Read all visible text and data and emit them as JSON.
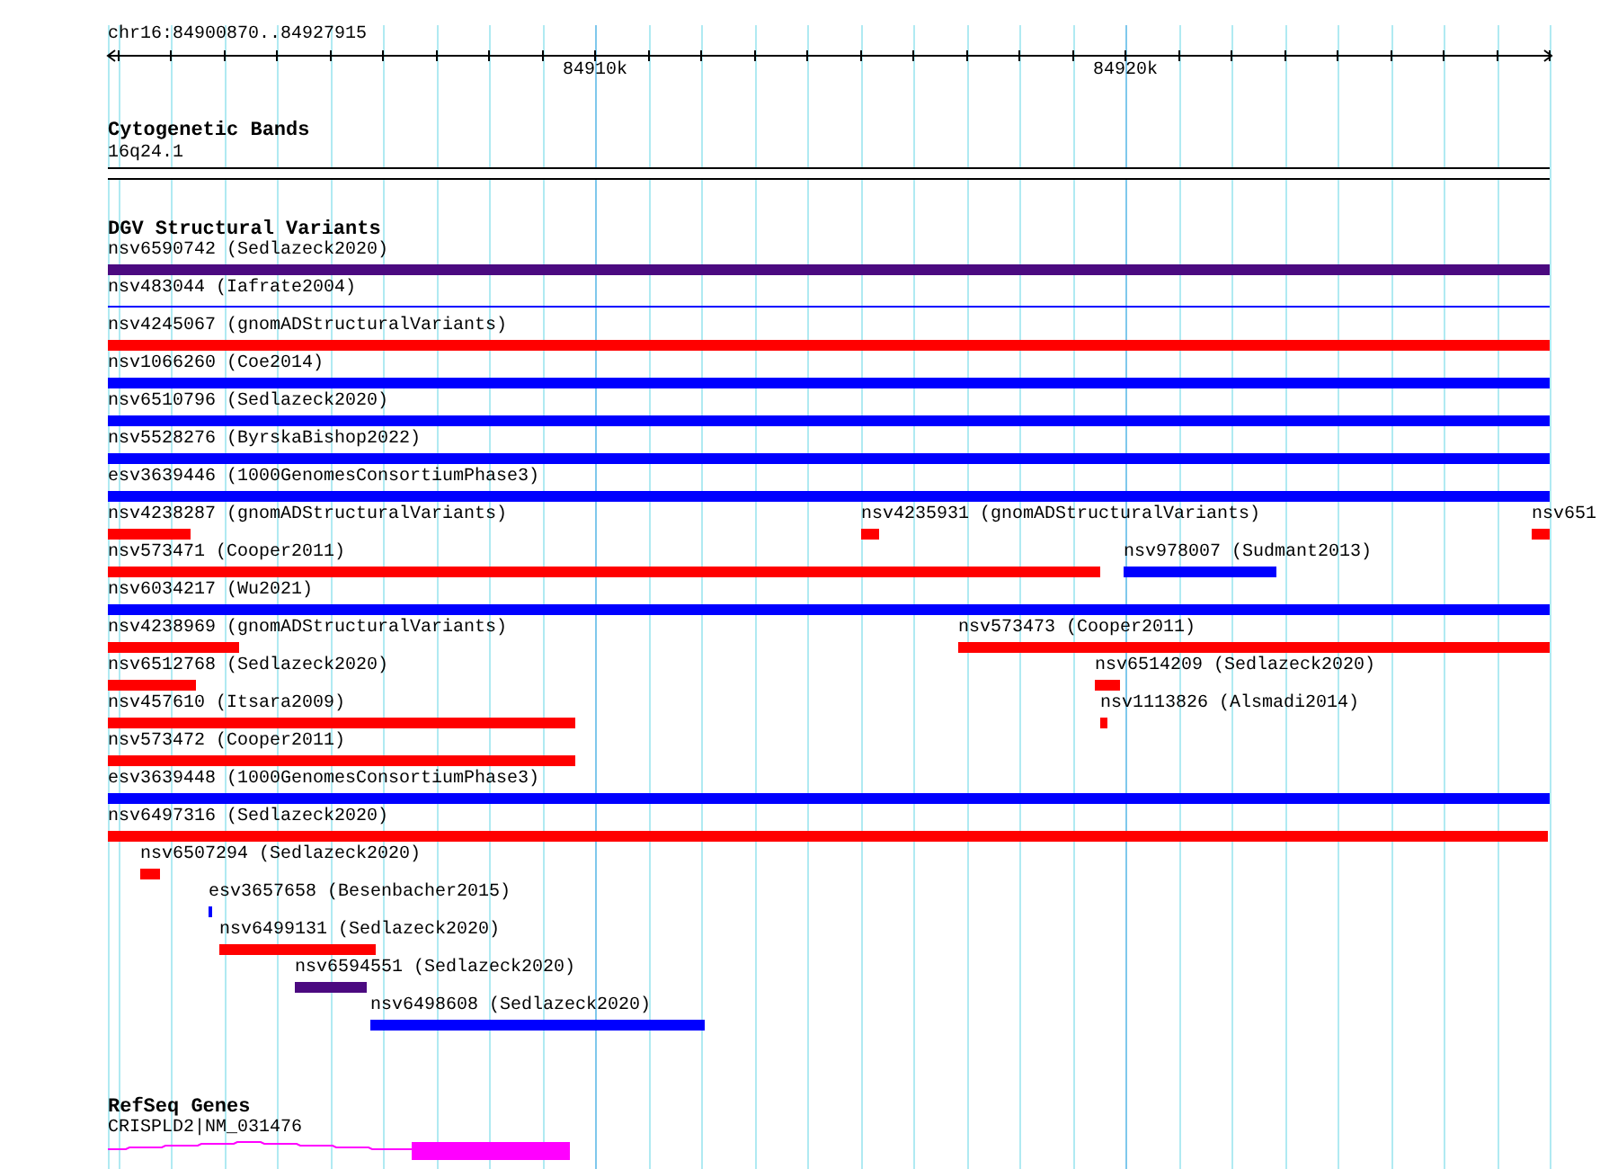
{
  "ruler": {
    "range": "chr16:84900870..84927915",
    "ticks": [
      "84910k",
      "84920k"
    ]
  },
  "cytoband_track": {
    "title": "Cytogenetic Bands",
    "band": "16q24.1"
  },
  "dgv_track": {
    "title": "DGV Structural Variants",
    "rows": [
      [
        {
          "label": "nsv6590742 (Sedlazeck2020)",
          "color": "#4b0a80"
        }
      ],
      [
        {
          "label": "nsv483044 (Iafrate2004)",
          "color": "#0000ff"
        }
      ],
      [
        {
          "label": "nsv4245067 (gnomADStructuralVariants)",
          "color": "#ff0000"
        }
      ],
      [
        {
          "label": "nsv1066260 (Coe2014)",
          "color": "#0000ff"
        }
      ],
      [
        {
          "label": "nsv6510796 (Sedlazeck2020)",
          "color": "#0000ff"
        }
      ],
      [
        {
          "label": "nsv5528276 (ByrskaBishop2022)",
          "color": "#0000ff"
        }
      ],
      [
        {
          "label": "esv3639446 (1000GenomesConsortiumPhase3)",
          "color": "#0000ff"
        }
      ],
      [
        {
          "label": "nsv4238287 (gnomADStructuralVariants)",
          "color": "#ff0000"
        },
        {
          "label": "nsv4235931 (gnomADStructuralVariants)",
          "color": "#ff0000"
        },
        {
          "label": "nsv651",
          "color": "#ff0000"
        }
      ],
      [
        {
          "label": "nsv573471 (Cooper2011)",
          "color": "#ff0000"
        },
        {
          "label": "nsv978007 (Sudmant2013)",
          "color": "#0000ff"
        }
      ],
      [
        {
          "label": "nsv6034217 (Wu2021)",
          "color": "#0000ff"
        }
      ],
      [
        {
          "label": "nsv4238969 (gnomADStructuralVariants)",
          "color": "#ff0000"
        },
        {
          "label": "nsv573473 (Cooper2011)",
          "color": "#ff0000"
        }
      ],
      [
        {
          "label": "nsv6512768 (Sedlazeck2020)",
          "color": "#ff0000"
        },
        {
          "label": "nsv6514209 (Sedlazeck2020)",
          "color": "#ff0000"
        }
      ],
      [
        {
          "label": "nsv457610 (Itsara2009)",
          "color": "#ff0000"
        },
        {
          "label": "nsv1113826 (Alsmadi2014)",
          "color": "#ff0000"
        }
      ],
      [
        {
          "label": "nsv573472 (Cooper2011)",
          "color": "#ff0000"
        }
      ],
      [
        {
          "label": "esv3639448 (1000GenomesConsortiumPhase3)",
          "color": "#0000ff"
        }
      ],
      [
        {
          "label": "nsv6497316 (Sedlazeck2020)",
          "color": "#ff0000"
        }
      ],
      [
        {
          "label": "nsv6507294 (Sedlazeck2020)",
          "color": "#ff0000"
        }
      ],
      [
        {
          "label": "esv3657658 (Besenbacher2015)",
          "color": "#0000ff"
        }
      ],
      [
        {
          "label": "nsv6499131 (Sedlazeck2020)",
          "color": "#ff0000"
        }
      ],
      [
        {
          "label": "nsv6594551 (Sedlazeck2020)",
          "color": "#4b0a80"
        }
      ],
      [
        {
          "label": "nsv6498608 (Sedlazeck2020)",
          "color": "#0000ff"
        }
      ]
    ]
  },
  "refseq_track": {
    "title": "RefSeq Genes",
    "gene": "CRISPLD2|NM_031476"
  }
}
